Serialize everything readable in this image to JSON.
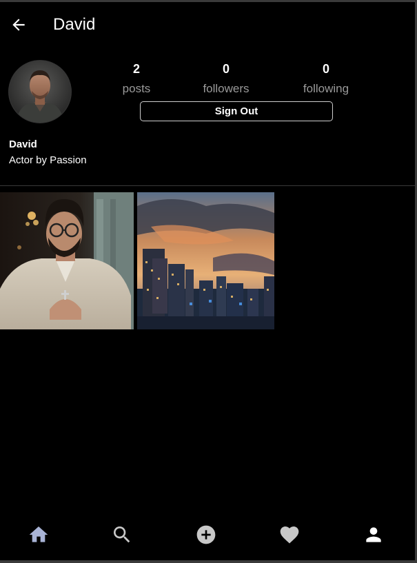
{
  "header": {
    "title": "David",
    "back_icon": "arrow-left-icon"
  },
  "profile": {
    "name": "David",
    "bio": "Actor by Passion",
    "avatar": "profile-photo"
  },
  "stats": {
    "posts": {
      "count": "2",
      "label": "posts"
    },
    "followers": {
      "count": "0",
      "label": "followers"
    },
    "following": {
      "count": "0",
      "label": "following"
    }
  },
  "actions": {
    "sign_out_label": "Sign Out"
  },
  "posts": [
    {
      "subject": "man-with-glasses-photo"
    },
    {
      "subject": "city-skyline-sunset-photo"
    }
  ],
  "bottom_nav": {
    "items": [
      {
        "icon": "home-icon",
        "color": "#a9b4d6"
      },
      {
        "icon": "search-icon",
        "color": "#c8c8c8"
      },
      {
        "icon": "add-circle-icon",
        "color": "#c8c8c8"
      },
      {
        "icon": "heart-icon",
        "color": "#c8c8c8"
      },
      {
        "icon": "person-icon",
        "color": "#ffffff"
      }
    ]
  },
  "colors": {
    "background": "#000000",
    "text_primary": "#ffffff",
    "text_secondary": "#9a9a9a",
    "divider": "#3a3a3a"
  }
}
